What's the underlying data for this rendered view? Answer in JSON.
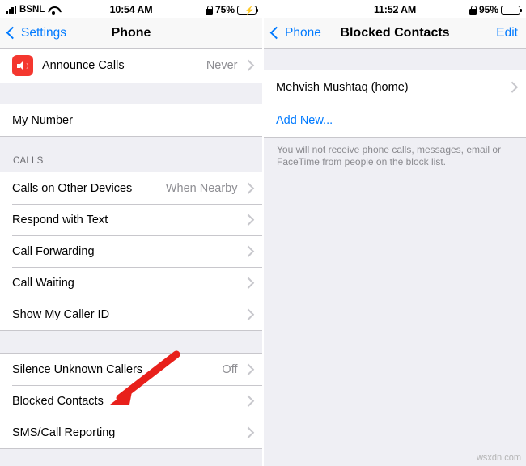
{
  "left_screen": {
    "status_bar": {
      "carrier": "BSNL",
      "time": "10:54 AM",
      "battery_pct": "75%",
      "battery_charging": true,
      "battery_color": "#4cd964",
      "signal_bars": 4,
      "icons": [
        "signal-icon",
        "wifi-icon",
        "battery-icon"
      ]
    },
    "nav": {
      "back_label": "Settings",
      "title": "Phone"
    },
    "groups": [
      {
        "rows": [
          {
            "label": "Announce Calls",
            "value": "Never",
            "icon": "announce-calls-icon",
            "chevron": true
          }
        ]
      },
      {
        "rows": [
          {
            "label": "My Number",
            "value": "",
            "chevron": false
          }
        ]
      },
      {
        "header": "CALLS",
        "rows": [
          {
            "label": "Calls on Other Devices",
            "value": "When Nearby",
            "chevron": true
          },
          {
            "label": "Respond with Text",
            "value": "",
            "chevron": true
          },
          {
            "label": "Call Forwarding",
            "value": "",
            "chevron": true
          },
          {
            "label": "Call Waiting",
            "value": "",
            "chevron": true
          },
          {
            "label": "Show My Caller ID",
            "value": "",
            "chevron": true
          }
        ]
      },
      {
        "rows": [
          {
            "label": "Silence Unknown Callers",
            "value": "Off",
            "chevron": true
          },
          {
            "label": "Blocked Contacts",
            "value": "",
            "chevron": true
          },
          {
            "label": "SMS/Call Reporting",
            "value": "",
            "chevron": true
          }
        ]
      }
    ],
    "annotation": {
      "type": "arrow",
      "color": "#e8201b",
      "points_to": "Blocked Contacts"
    }
  },
  "right_screen": {
    "status_bar": {
      "carrier": "",
      "time": "11:52 AM",
      "battery_pct": "95%",
      "battery_charging": false,
      "battery_color": "#000000",
      "icons": [
        "lock-icon",
        "battery-icon"
      ]
    },
    "nav": {
      "back_label": "Phone",
      "title": "Blocked Contacts",
      "right_label": "Edit"
    },
    "groups": [
      {
        "rows": [
          {
            "label": "Mehvish Mushtaq (home)",
            "value": "",
            "chevron": true
          },
          {
            "label": "Add New...",
            "value": "",
            "chevron": false,
            "style": "blue"
          }
        ]
      }
    ],
    "footnote": "You will not receive phone calls, messages, email or FaceTime from people on the block list."
  },
  "watermark": "wsxdn.com"
}
